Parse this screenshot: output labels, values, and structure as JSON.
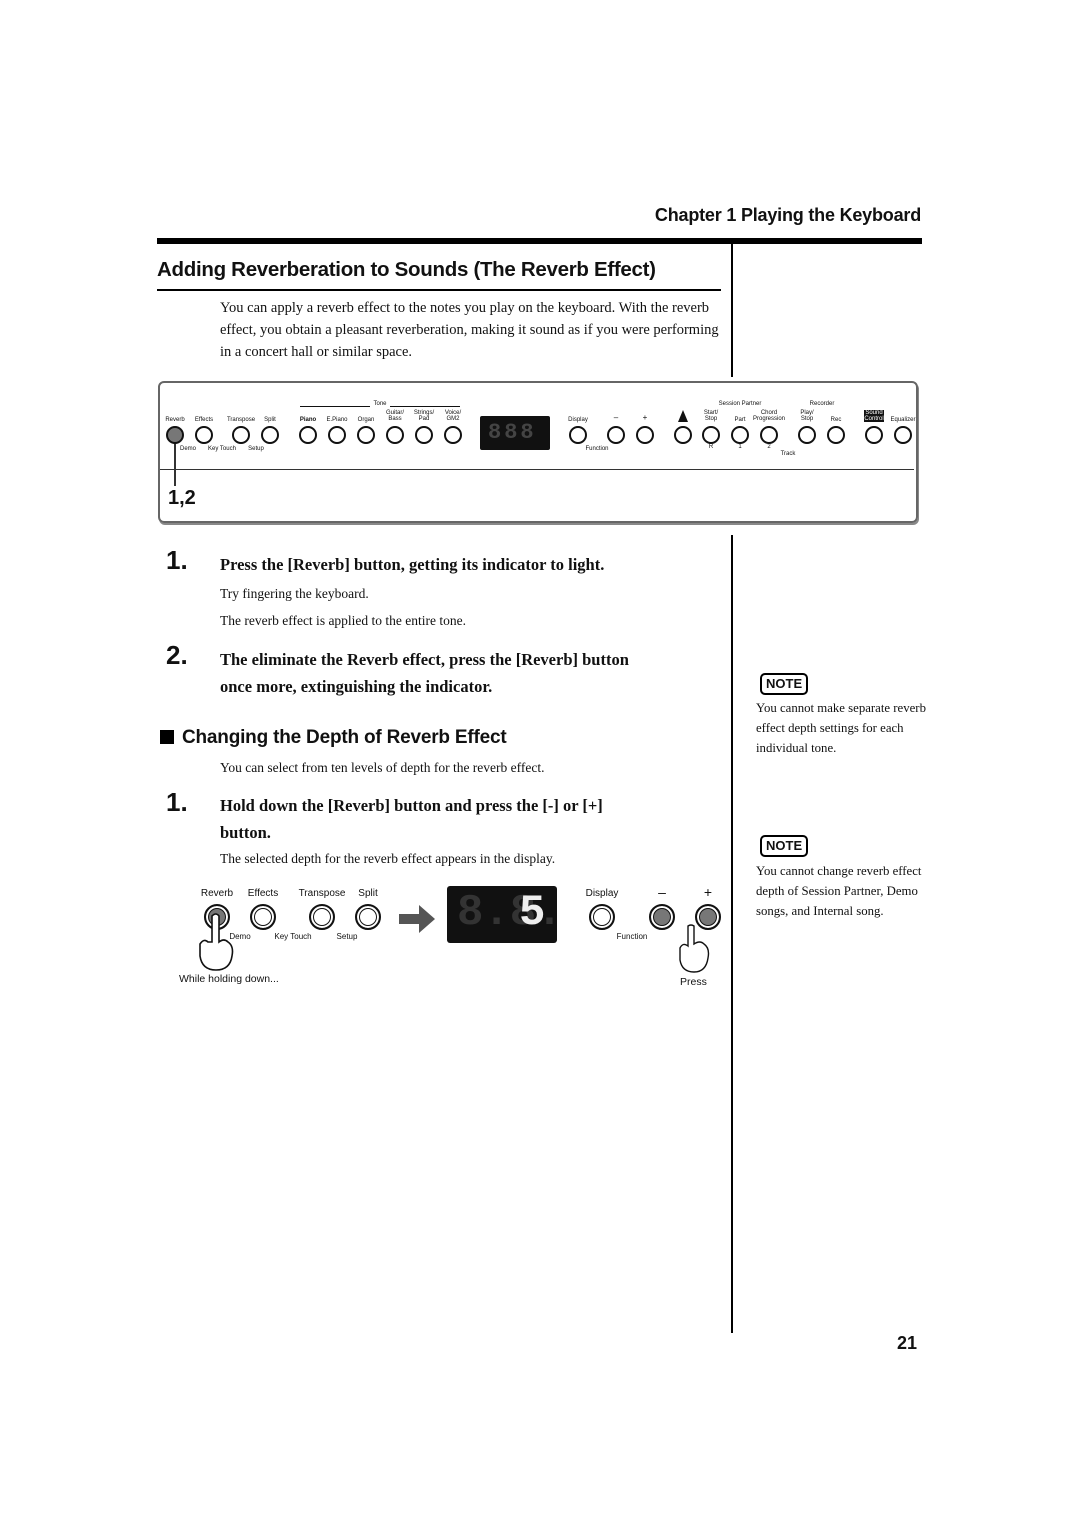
{
  "header": {
    "chapter": "Chapter 1 Playing the Keyboard"
  },
  "section": {
    "title": "Adding Reverberation to Sounds (The Reverb Effect)",
    "intro": "You can apply a reverb effect to the notes you play on the keyboard. With the reverb effect, you obtain a pleasant reverberation, making it sound as if you were performing in a concert hall or similar space."
  },
  "panel": {
    "step_label": "1,2",
    "buttons": [
      {
        "label": "Reverb",
        "lit": true
      },
      {
        "label": "Effects"
      },
      {
        "label": "Transpose"
      },
      {
        "label": "Split"
      },
      {
        "label": "Piano"
      },
      {
        "label": "E.Piano"
      },
      {
        "label": "Organ"
      },
      {
        "label": "Guitar/ Bass"
      },
      {
        "label": "Strings/ Pad"
      },
      {
        "label": "Voice/ GM2"
      },
      {
        "label": "Display"
      },
      {
        "label": "–"
      },
      {
        "label": "+"
      },
      {
        "label": "metronome"
      },
      {
        "label": "Start/ Stop"
      },
      {
        "label": "Part"
      },
      {
        "label": "Chord Progression"
      },
      {
        "label": "Play/ Stop"
      },
      {
        "label": "Rec"
      },
      {
        "label": "Sound Control"
      },
      {
        "label": "Equalizer"
      }
    ],
    "groups": {
      "tone": "Tone",
      "session_partner": "Session Partner",
      "recorder": "Recorder"
    },
    "sublabels": {
      "demo": "Demo",
      "key_touch": "Key Touch",
      "setup": "Setup",
      "function": "Function",
      "track": "Track",
      "track_r": "R",
      "track_1": "1",
      "track_2": "2"
    },
    "display": "888"
  },
  "steps_part1": [
    {
      "number": "1.",
      "title": "Press the [Reverb] button, getting its indicator to light.",
      "body": [
        "Try fingering the keyboard.",
        "The reverb effect is applied to the entire tone."
      ]
    },
    {
      "number": "2.",
      "title_line1": "The eliminate the Reverb effect, press the [Reverb] button",
      "title_line2": "once more, extinguishing the indicator."
    }
  ],
  "subsection": {
    "title": "Changing the Depth of Reverb Effect",
    "intro": "You can select from ten levels of depth for the reverb effect.",
    "step": {
      "number": "1.",
      "title_line1": "Hold down the [Reverb] button and press the [-] or [+]",
      "title_line2": "button.",
      "body": "The selected depth for the reverb effect appears in the display."
    }
  },
  "illustration": {
    "labels": {
      "reverb": "Reverb",
      "effects": "Effects",
      "transpose": "Transpose",
      "split": "Split",
      "display": "Display",
      "minus": "–",
      "plus": "+",
      "demo": "Demo",
      "key_touch": "Key Touch",
      "setup": "Setup",
      "function": "Function"
    },
    "display_value": "5",
    "caption_left": "While holding down...",
    "caption_right": "Press"
  },
  "notes": [
    {
      "badge": "NOTE",
      "text": "You cannot make separate reverb effect depth settings for each individual tone."
    },
    {
      "badge": "NOTE",
      "text": "You cannot change reverb effect depth of Session Partner, Demo songs, and Internal song."
    }
  ],
  "page_number": "21"
}
